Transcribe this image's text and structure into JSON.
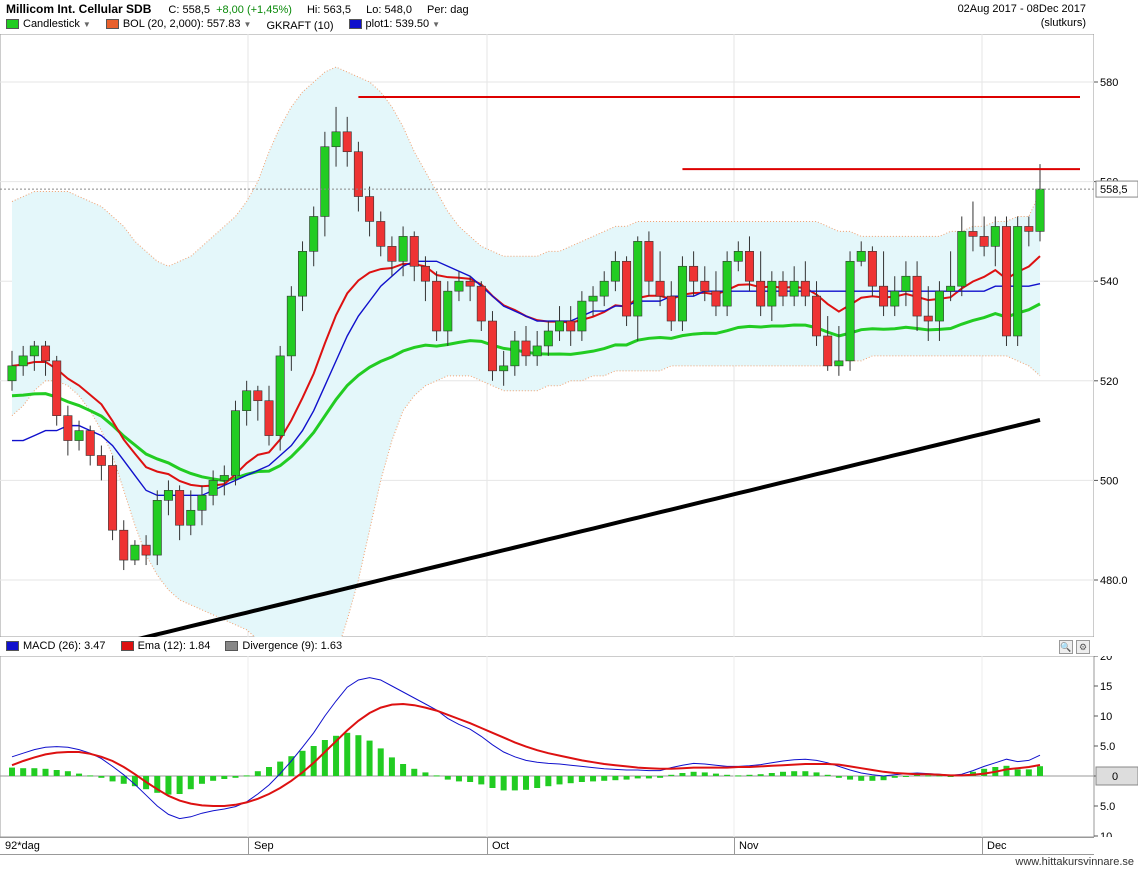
{
  "header": {
    "title": "Millicom Int. Cellular SDB",
    "close_label": "C:",
    "close_value": "558,5",
    "change": "+8,00 (+1,45%)",
    "high_label": "Hi:",
    "high_value": "563,5",
    "low_label": "Lo:",
    "low_value": "548,0",
    "period_label": "Per:",
    "period_value": "dag",
    "date_range": "02Aug 2017 - 08Dec 2017",
    "price_type": "(slutkurs)"
  },
  "legend": [
    {
      "label": "Candlestick",
      "color": "#22cc22",
      "dropdown": true
    },
    {
      "label": "BOL (20, 2,000): 557.83",
      "color": "#e8602c",
      "dropdown": true
    },
    {
      "label": "GKRAFT (10)",
      "color": "",
      "dropdown": false
    },
    {
      "label": "plot1: 539.50",
      "color": "#1010cc",
      "dropdown": true
    }
  ],
  "macd_legend": [
    {
      "label": "MACD (26): 3.47",
      "color": "#1010cc"
    },
    {
      "label": "Ema (12): 1.84",
      "color": "#dd1111"
    },
    {
      "label": "Divergence (9): 1.63",
      "color": "#888888"
    }
  ],
  "price_axis": {
    "ticks": [
      "580",
      "560",
      "540",
      "520",
      "500",
      "480.0"
    ],
    "last_price": "558,5"
  },
  "macd_axis": {
    "ticks": [
      "20",
      "15",
      "10",
      "5.0",
      "0",
      "5.0",
      "10"
    ],
    "zero_label": "0"
  },
  "time_axis": {
    "first_label": "92*dag",
    "labels": [
      "Sep",
      "Oct",
      "Nov",
      "Dec"
    ]
  },
  "credit": "www.hittakursvinnare.se",
  "colors": {
    "up": "#22cc22",
    "down": "#ee3333",
    "ma_black": "#000000",
    "ma_green": "#22cc22",
    "ma_red": "#dd1111",
    "ma_blue": "#1010cc",
    "bollinger_fill": "#e4f7fa",
    "resistance": "#dd0000"
  },
  "chart_data": [
    {
      "type": "candlestick",
      "title": "Millicom Int. Cellular SDB",
      "ylim": [
        462,
        590
      ],
      "x": [
        "2017-08-02",
        "2017-08-03",
        "2017-08-04",
        "2017-08-07",
        "2017-08-08",
        "2017-08-09",
        "2017-08-10",
        "2017-08-11",
        "2017-08-14",
        "2017-08-15",
        "2017-08-16",
        "2017-08-17",
        "2017-08-18",
        "2017-08-21",
        "2017-08-22",
        "2017-08-23",
        "2017-08-24",
        "2017-08-25",
        "2017-08-28",
        "2017-08-29",
        "2017-08-30",
        "2017-08-31",
        "2017-09-01",
        "2017-09-04",
        "2017-09-05",
        "2017-09-06",
        "2017-09-07",
        "2017-09-08",
        "2017-09-11",
        "2017-09-12",
        "2017-09-13",
        "2017-09-14",
        "2017-09-15",
        "2017-09-18",
        "2017-09-19",
        "2017-09-20",
        "2017-09-21",
        "2017-09-22",
        "2017-09-25",
        "2017-09-26",
        "2017-09-27",
        "2017-09-28",
        "2017-09-29",
        "2017-10-02",
        "2017-10-03",
        "2017-10-04",
        "2017-10-05",
        "2017-10-06",
        "2017-10-09",
        "2017-10-10",
        "2017-10-11",
        "2017-10-12",
        "2017-10-13",
        "2017-10-16",
        "2017-10-17",
        "2017-10-18",
        "2017-10-19",
        "2017-10-20",
        "2017-10-23",
        "2017-10-24",
        "2017-10-25",
        "2017-10-26",
        "2017-10-27",
        "2017-10-30",
        "2017-10-31",
        "2017-11-01",
        "2017-11-02",
        "2017-11-03",
        "2017-11-06",
        "2017-11-07",
        "2017-11-08",
        "2017-11-09",
        "2017-11-10",
        "2017-11-13",
        "2017-11-14",
        "2017-11-15",
        "2017-11-16",
        "2017-11-17",
        "2017-11-20",
        "2017-11-21",
        "2017-11-22",
        "2017-11-23",
        "2017-11-24",
        "2017-11-27",
        "2017-11-28",
        "2017-11-29",
        "2017-11-30",
        "2017-12-01",
        "2017-12-04",
        "2017-12-05",
        "2017-12-06",
        "2017-12-07",
        "2017-12-08"
      ],
      "open": [
        520,
        523,
        525,
        527,
        524,
        513,
        508,
        510,
        505,
        503,
        490,
        484,
        487,
        485,
        496,
        498,
        491,
        494,
        497,
        500,
        501,
        514,
        518,
        516,
        509,
        525,
        537,
        546,
        553,
        567,
        570,
        566,
        557,
        552,
        547,
        544,
        549,
        543,
        540,
        530,
        538,
        540,
        539,
        532,
        522,
        523,
        528,
        525,
        527,
        530,
        532,
        530,
        536,
        537,
        540,
        544,
        533,
        548,
        540,
        537,
        532,
        543,
        540,
        538,
        535,
        544,
        546,
        540,
        535,
        540,
        537,
        540,
        537,
        529,
        523,
        524,
        544,
        546,
        539,
        535,
        538,
        541,
        533,
        532,
        538,
        539,
        550,
        549,
        547,
        551,
        529,
        551,
        550
      ],
      "close": [
        523,
        525,
        527,
        524,
        513,
        508,
        510,
        505,
        503,
        490,
        484,
        487,
        485,
        496,
        498,
        491,
        494,
        497,
        500,
        501,
        514,
        518,
        516,
        509,
        525,
        537,
        546,
        553,
        567,
        570,
        566,
        557,
        552,
        547,
        544,
        549,
        543,
        540,
        530,
        538,
        540,
        539,
        532,
        522,
        523,
        528,
        525,
        527,
        530,
        532,
        530,
        536,
        537,
        540,
        544,
        533,
        548,
        540,
        537,
        532,
        543,
        540,
        538,
        535,
        544,
        546,
        540,
        535,
        540,
        537,
        540,
        537,
        529,
        523,
        524,
        544,
        546,
        539,
        535,
        538,
        541,
        533,
        532,
        538,
        539,
        550,
        549,
        547,
        551,
        529,
        551,
        550,
        558.5
      ],
      "high": [
        526,
        527,
        528,
        528,
        525,
        515,
        512,
        511,
        507,
        505,
        492,
        488,
        489,
        498,
        500,
        499,
        498,
        499,
        502,
        503,
        516,
        520,
        519,
        519,
        527,
        539,
        548,
        555,
        570,
        575,
        573,
        568,
        559,
        554,
        549,
        551,
        550,
        545,
        542,
        540,
        542,
        541,
        540,
        534,
        526,
        530,
        531,
        530,
        532,
        535,
        535,
        538,
        539,
        542,
        546,
        545,
        549,
        550,
        546,
        540,
        545,
        546,
        543,
        542,
        546,
        548,
        549,
        546,
        542,
        542,
        543,
        544,
        540,
        533,
        531,
        546,
        548,
        547,
        546,
        541,
        544,
        544,
        539,
        540,
        546,
        553,
        556,
        553,
        553,
        553,
        553,
        553,
        563.5
      ],
      "low": [
        518,
        521,
        522,
        521,
        511,
        505,
        506,
        503,
        500,
        488,
        482,
        483,
        483,
        483,
        493,
        488,
        489,
        491,
        495,
        497,
        499,
        511,
        512,
        507,
        506,
        522,
        534,
        543,
        549,
        563,
        563,
        554,
        549,
        545,
        541,
        541,
        540,
        536,
        528,
        527,
        536,
        536,
        530,
        520,
        519,
        521,
        523,
        523,
        525,
        528,
        527,
        528,
        533,
        535,
        538,
        531,
        528,
        537,
        535,
        530,
        530,
        537,
        536,
        533,
        533,
        542,
        538,
        533,
        532,
        535,
        535,
        535,
        527,
        522,
        521,
        522,
        543,
        537,
        533,
        533,
        535,
        530,
        528,
        528,
        536,
        537,
        546,
        545,
        543,
        527,
        527,
        547,
        548
      ]
    },
    {
      "type": "line",
      "title": "Moving averages and Bollinger bands",
      "series": [
        {
          "name": "plot1: 539.50",
          "values": [
            508,
            508,
            509,
            510,
            510,
            511,
            511,
            510,
            509,
            507,
            504,
            501,
            498,
            497,
            497,
            497,
            497,
            497,
            498,
            499,
            500,
            501,
            502,
            503,
            505,
            507,
            510,
            514,
            519,
            524,
            529,
            533,
            536,
            539,
            541,
            543,
            544,
            544,
            544,
            543,
            542,
            541,
            539,
            537,
            535,
            534,
            533,
            532,
            532,
            532,
            532,
            533,
            534,
            534,
            535,
            535,
            536,
            536,
            536,
            537,
            537,
            537,
            538,
            538,
            538,
            538,
            538,
            538,
            538,
            538,
            538,
            538,
            538,
            538,
            538,
            538,
            538,
            538,
            538,
            538,
            538,
            538,
            538,
            538,
            538,
            538,
            538,
            538,
            539,
            539,
            539,
            539,
            539.5
          ]
        },
        {
          "name": "BOL (20, 2,000): 557.83",
          "values": [
            556,
            557,
            558,
            558,
            558,
            558,
            557,
            556,
            555,
            553,
            551,
            548,
            546,
            544,
            543,
            544,
            545,
            547,
            549,
            551,
            553,
            556,
            560,
            566,
            571,
            575,
            578,
            580,
            582,
            583,
            582,
            581,
            580,
            578,
            575,
            571,
            566,
            562,
            558,
            554,
            551,
            549,
            547,
            546,
            545,
            545,
            545,
            545,
            546,
            546,
            547,
            548,
            549,
            550,
            551,
            551,
            552,
            552,
            552,
            552,
            552,
            552,
            552,
            552,
            552,
            552,
            552,
            552,
            552,
            552,
            552,
            552,
            552,
            551,
            550,
            550,
            549,
            549,
            549,
            549,
            549,
            549,
            549,
            549,
            550,
            550,
            551,
            551,
            552,
            552,
            553,
            553,
            557.83
          ]
        },
        {
          "name": "",
          "values": [
            513,
            515,
            518,
            520,
            520,
            519,
            517,
            514,
            510,
            505,
            498,
            491,
            485,
            481,
            478,
            476,
            475,
            474,
            473,
            472,
            471,
            470,
            468,
            466,
            463,
            460,
            458,
            458,
            460,
            465,
            472,
            480,
            490,
            500,
            508,
            514,
            517,
            519,
            520,
            521,
            521,
            521,
            520,
            519,
            518,
            518,
            518,
            518,
            519,
            519,
            520,
            520,
            521,
            521,
            522,
            522,
            522,
            522,
            522,
            523,
            523,
            523,
            523,
            523,
            523,
            523,
            523,
            523,
            523,
            523,
            523,
            523,
            523,
            523,
            524,
            524,
            524,
            525,
            525,
            525,
            525,
            525,
            525,
            525,
            525,
            525,
            525,
            525,
            525,
            525,
            524,
            523,
            521
          ]
        }
      ]
    },
    {
      "type": "bar",
      "title": "MACD (26): 3.47",
      "ylim": [
        -11,
        21
      ],
      "series": [
        {
          "name": "MACD (26): 3.47",
          "values": [
            3.2,
            3.8,
            4.4,
            4.8,
            4.9,
            4.8,
            4.4,
            3.8,
            2.9,
            1.6,
            0.2,
            -1.4,
            -3.2,
            -5.0,
            -6.4,
            -7.1,
            -6.8,
            -6.2,
            -5.8,
            -5.5,
            -5.1,
            -4.3,
            -3.0,
            -1.5,
            0.4,
            2.5,
            4.8,
            7.2,
            10.0,
            12.5,
            14.8,
            16.0,
            16.4,
            16.0,
            15.0,
            14.0,
            13.0,
            12.0,
            11.0,
            9.6,
            8.6,
            7.8,
            6.6,
            5.2,
            4.0,
            3.2,
            2.6,
            2.3,
            2.1,
            2.0,
            1.8,
            1.6,
            1.4,
            1.2,
            1.1,
            1.0,
            1.0,
            0.9,
            0.9,
            1.4,
            1.8,
            2.1,
            2.0,
            1.8,
            1.6,
            1.6,
            1.7,
            1.9,
            2.2,
            2.5,
            2.7,
            2.8,
            2.6,
            2.2,
            1.6,
            1.0,
            0.5,
            0.2,
            0.0,
            0.2,
            0.4,
            0.5,
            0.4,
            0.3,
            0.1,
            0.3,
            0.9,
            1.6,
            2.2,
            2.8,
            2.4,
            2.6,
            3.47
          ]
        },
        {
          "name": "Ema (12): 1.84",
          "values": [
            1.8,
            2.5,
            3.1,
            3.6,
            3.9,
            4.0,
            4.0,
            3.7,
            3.2,
            2.5,
            1.5,
            0.3,
            -1.0,
            -2.2,
            -3.3,
            -4.1,
            -4.6,
            -4.9,
            -5.0,
            -5.0,
            -4.8,
            -4.4,
            -3.8,
            -3.0,
            -2.0,
            -0.8,
            0.6,
            2.2,
            4.0,
            5.8,
            7.6,
            9.2,
            10.5,
            11.4,
            11.9,
            12.0,
            11.8,
            11.4,
            10.9,
            10.2,
            9.5,
            8.8,
            8.0,
            7.2,
            6.4,
            5.6,
            4.9,
            4.3,
            3.8,
            3.4,
            3.0,
            2.6,
            2.3,
            2.0,
            1.8,
            1.6,
            1.4,
            1.3,
            1.2,
            1.2,
            1.3,
            1.4,
            1.4,
            1.4,
            1.4,
            1.5,
            1.5,
            1.6,
            1.7,
            1.8,
            1.9,
            2.0,
            2.0,
            2.0,
            1.9,
            1.6,
            1.3,
            1.0,
            0.7,
            0.5,
            0.4,
            0.3,
            0.3,
            0.2,
            0.1,
            0.1,
            0.2,
            0.4,
            0.7,
            1.1,
            1.3,
            1.5,
            1.84
          ]
        },
        {
          "name": "Divergence (9): 1.63",
          "values": [
            1.4,
            1.3,
            1.3,
            1.2,
            1.0,
            0.8,
            0.4,
            0.1,
            -0.3,
            -0.9,
            -1.3,
            -1.7,
            -2.2,
            -2.8,
            -3.1,
            -3.0,
            -2.2,
            -1.3,
            -0.8,
            -0.5,
            -0.3,
            0.1,
            0.8,
            1.5,
            2.4,
            3.3,
            4.2,
            5.0,
            6.0,
            6.7,
            7.2,
            6.8,
            5.9,
            4.6,
            3.1,
            2.0,
            1.2,
            0.6,
            0.1,
            -0.6,
            -0.9,
            -1.0,
            -1.4,
            -2.0,
            -2.4,
            -2.4,
            -2.3,
            -2.0,
            -1.7,
            -1.4,
            -1.2,
            -1.0,
            -0.9,
            -0.8,
            -0.7,
            -0.6,
            -0.4,
            -0.4,
            -0.3,
            0.2,
            0.5,
            0.7,
            0.6,
            0.4,
            0.2,
            0.1,
            0.2,
            0.3,
            0.5,
            0.7,
            0.8,
            0.8,
            0.6,
            0.2,
            -0.3,
            -0.6,
            -0.8,
            -0.8,
            -0.7,
            -0.3,
            0.0,
            0.2,
            0.1,
            0.1,
            0.0,
            0.2,
            0.7,
            1.2,
            1.5,
            1.7,
            1.1,
            1.1,
            1.63
          ]
        }
      ]
    }
  ],
  "resistance_levels": [
    {
      "value": 577,
      "from": "2017-09-14",
      "to": "2017-12-08"
    },
    {
      "value": 562.5,
      "from": "2017-10-25",
      "to": "2017-12-08"
    }
  ]
}
